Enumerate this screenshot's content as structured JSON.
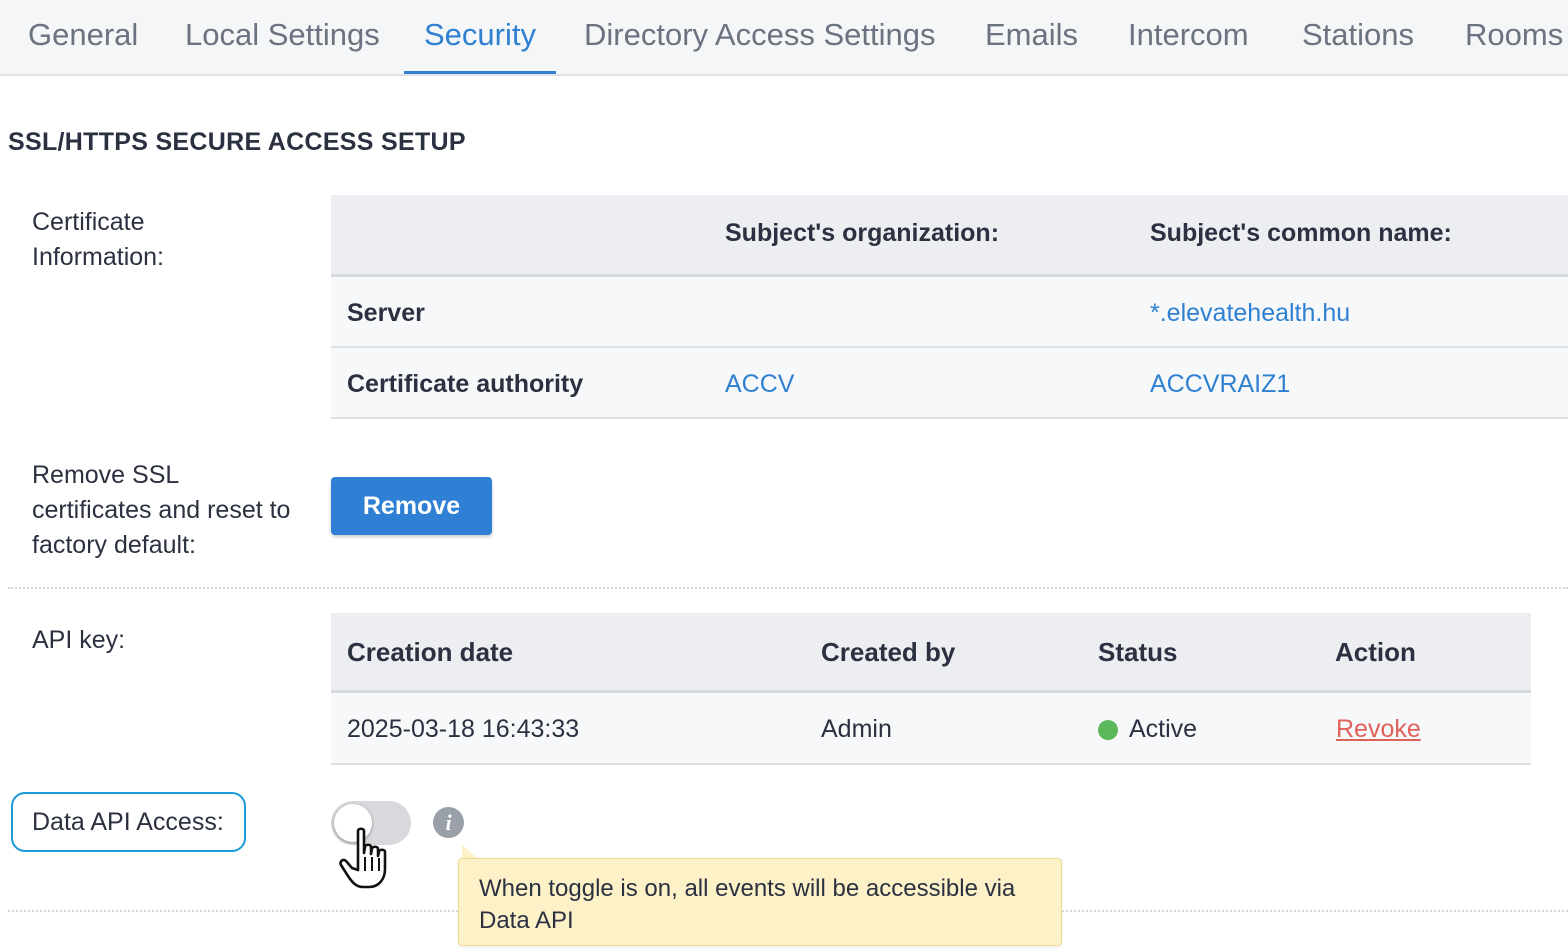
{
  "tabs": [
    {
      "label": "General"
    },
    {
      "label": "Local Settings"
    },
    {
      "label": "Security",
      "active": true
    },
    {
      "label": "Directory Access Settings"
    },
    {
      "label": "Emails"
    },
    {
      "label": "Intercom"
    },
    {
      "label": "Stations"
    },
    {
      "label": "Rooms"
    }
  ],
  "section_title": "SSL/HTTPS SECURE ACCESS SETUP",
  "certificate": {
    "label": "Certificate Information:",
    "headers": {
      "organization": "Subject's organization:",
      "common_name": "Subject's common name:"
    },
    "rows": [
      {
        "name": "Server",
        "organization": "",
        "common_name": "*.elevatehealth.hu"
      },
      {
        "name": "Certificate authority",
        "organization": "ACCV",
        "common_name": "ACCVRAIZ1"
      }
    ]
  },
  "remove_ssl": {
    "label": "Remove SSL certificates and reset to factory default:",
    "button_label": "Remove"
  },
  "api_key": {
    "label": "API key:",
    "headers": {
      "creation_date": "Creation date",
      "created_by": "Created by",
      "status": "Status",
      "action": "Action"
    },
    "rows": [
      {
        "creation_date": "2025-03-18 16:43:33",
        "created_by": "Admin",
        "status": "Active",
        "action": "Revoke"
      }
    ],
    "status_color": "#5cb85c"
  },
  "data_api": {
    "label": "Data API Access:",
    "enabled": false,
    "tooltip": "When toggle is on, all events will be accessible via Data API"
  },
  "colors": {
    "accent": "#2f80d0",
    "danger": "#e0605a",
    "highlight_border": "#1a9bd7",
    "tooltip_bg": "#fdf1c8"
  }
}
